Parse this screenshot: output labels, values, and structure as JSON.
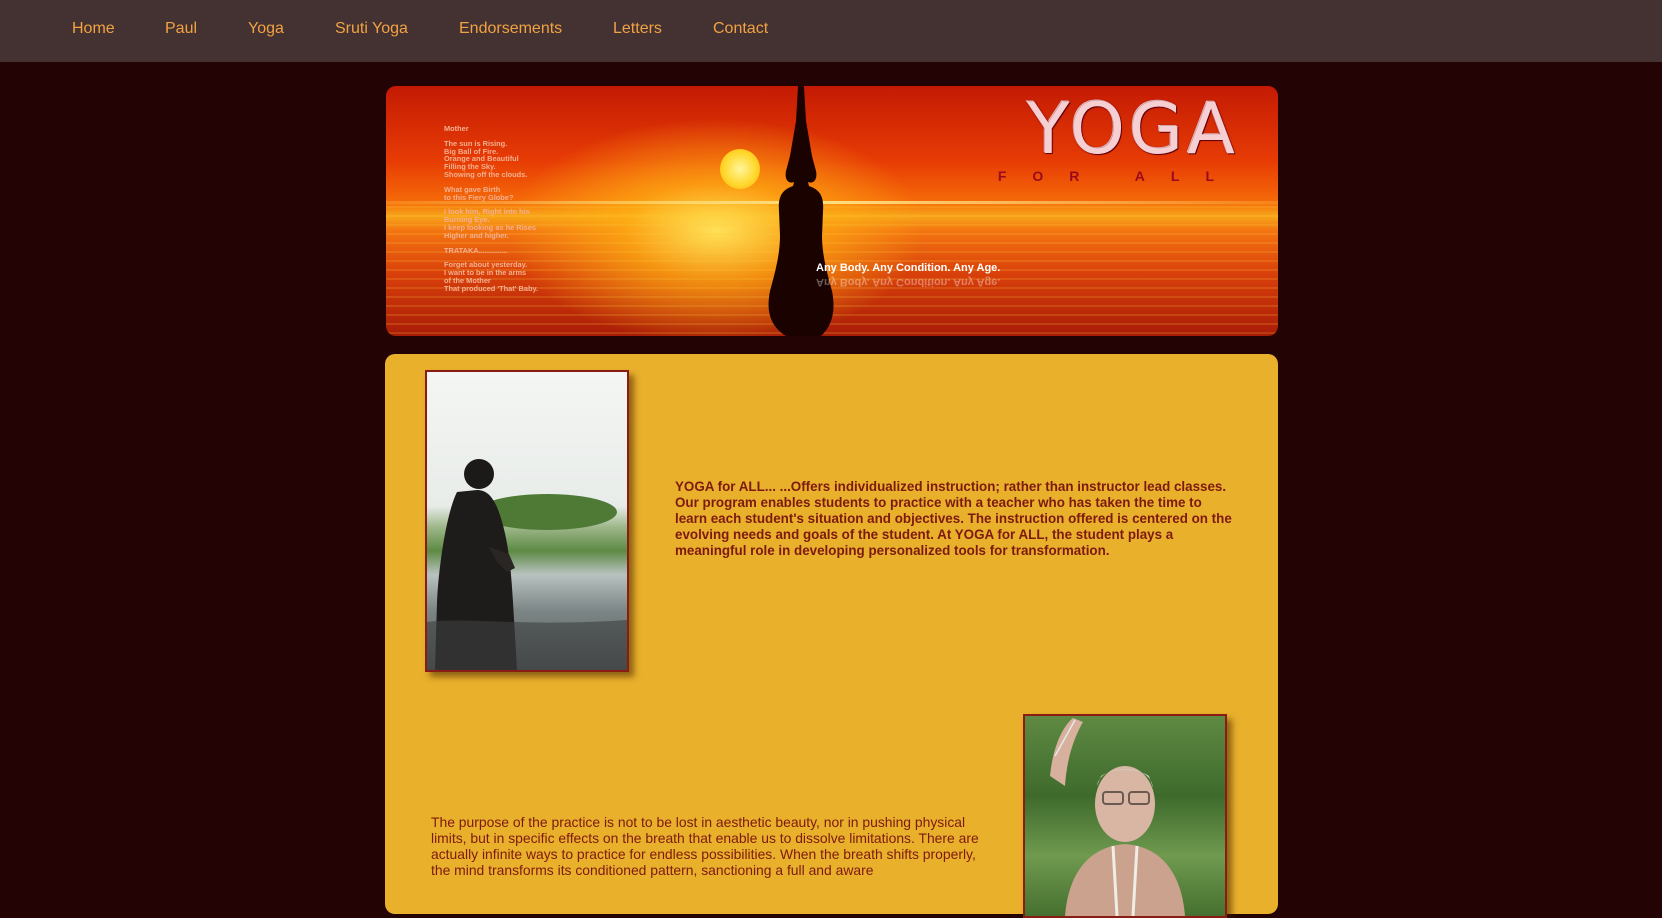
{
  "nav": {
    "items": [
      {
        "label": "Home"
      },
      {
        "label": "Paul"
      },
      {
        "label": "Yoga"
      },
      {
        "label": "Sruti Yoga"
      },
      {
        "label": "Endorsements"
      },
      {
        "label": "Letters"
      },
      {
        "label": "Contact"
      }
    ]
  },
  "banner": {
    "logo_title": "YOGA",
    "logo_subtitle": "FOR ALL",
    "tagline": "Any Body.  Any Condition.   Any Age.",
    "poem": {
      "title": "Mother",
      "stanza1": [
        "The sun is Rising.",
        "Big Ball of Fire.",
        "Orange and Beautiful",
        "Filling the Sky.",
        "Showing off the clouds."
      ],
      "stanza2": [
        "What gave Birth",
        "to this Fiery Globe?"
      ],
      "stanza3": [
        "I look him, Right into his",
        "Burning Eye.",
        "I keep looking as he Rises",
        "Higher and higher."
      ],
      "stanza4": [
        "TRATAKA.............."
      ],
      "stanza5": [
        "Forget about yesterday.",
        "I want to be in the arms",
        "of the Mother",
        "That produced 'That' Baby."
      ]
    }
  },
  "content": {
    "paragraph1": "YOGA for ALL... ...Offers individualized instruction; rather than instructor lead classes. Our program enables students to practice with a teacher who has taken the time to learn each student's situation and objectives. The instruction offered is centered on the evolving needs and goals of the student. At YOGA for ALL, the student plays a meaningful role in developing personalized tools for transformation.",
    "paragraph2": "The purpose of the practice is not to be lost in aesthetic beauty, nor in pushing physical limits, but in specific effects on the breath that enable us to dissolve limitations. There are actually infinite ways to practice for endless possibilities. When the breath shifts properly, the mind transforms its conditioned pattern, sanctioning a full and aware"
  },
  "colors": {
    "page_bg": "#230303",
    "nav_bg": "#443131",
    "nav_link": "#f1a343",
    "panel_bg": "#e9b02c",
    "text": "#7d1a10",
    "photo_border": "#8b1c14"
  }
}
